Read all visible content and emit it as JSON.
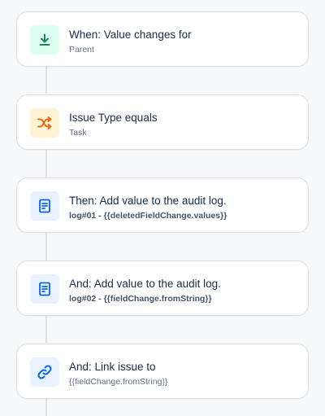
{
  "rules": [
    {
      "title": "When: Value changes for",
      "subtitle": "Parent",
      "icon": "download-arrow-icon",
      "icon_color": "#1f845a",
      "icon_bg": "#dcfff1"
    },
    {
      "title": "Issue Type equals",
      "subtitle": "Task",
      "icon": "shuffle-icon",
      "icon_color": "#e56910",
      "icon_bg": "#fff3d6"
    },
    {
      "title": "Then: Add value to the audit log.",
      "subtitle": "log#01 - {{deletedFieldChange.values}}",
      "icon": "document-icon",
      "icon_color": "#0c66e4",
      "icon_bg": "#e9f2ff"
    },
    {
      "title": "And: Add value to the audit log.",
      "subtitle": "log#02 - {{fieldChange.fromString}}",
      "icon": "document-icon",
      "icon_color": "#0c66e4",
      "icon_bg": "#e9f2ff"
    },
    {
      "title": "And: Link issue to",
      "subtitle": "{{fieldChange.fromString}}",
      "icon": "link-icon",
      "icon_color": "#0c66e4",
      "icon_bg": "#e9f2ff"
    }
  ]
}
